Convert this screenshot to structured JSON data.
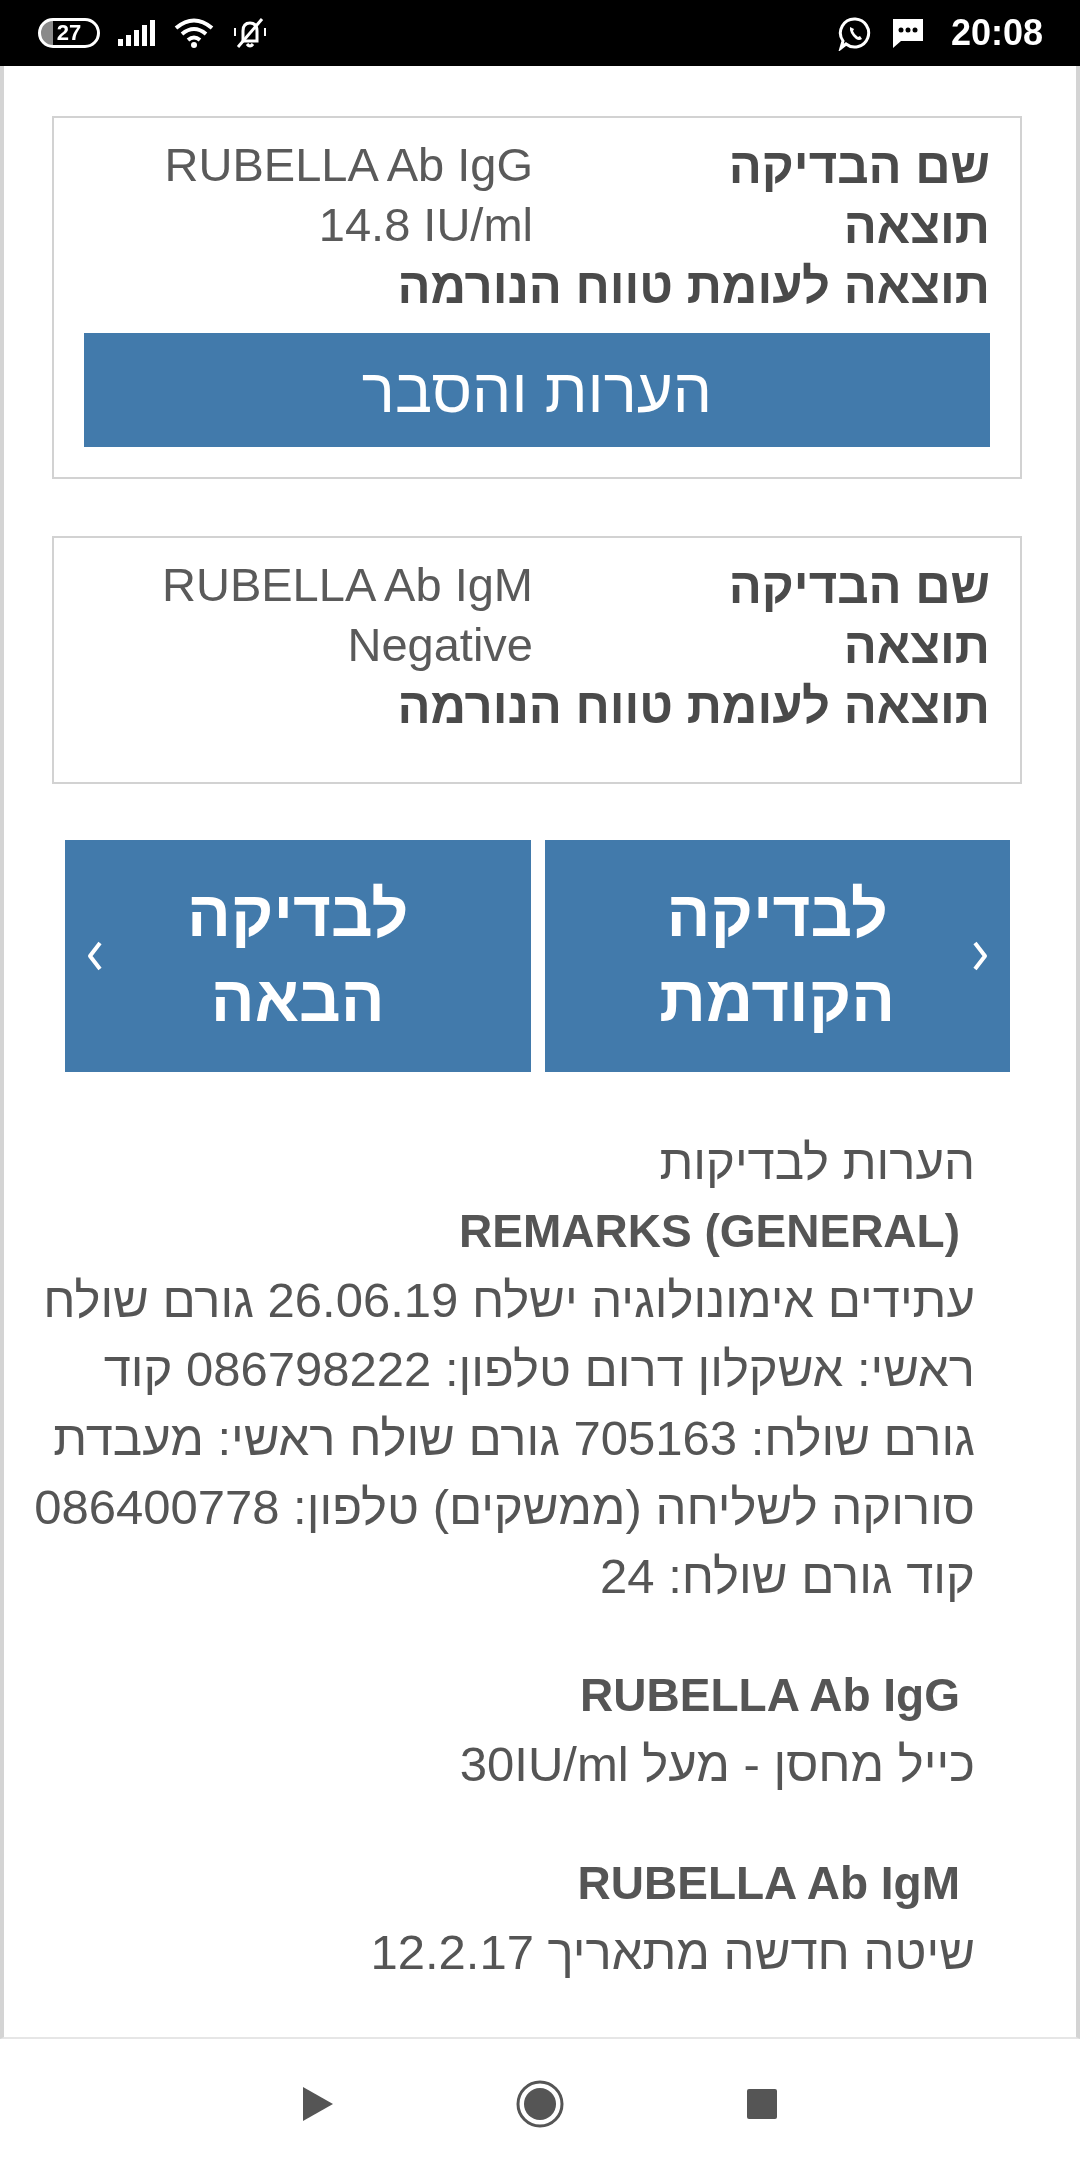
{
  "status_bar": {
    "battery": "27",
    "time": "20:08"
  },
  "tests": [
    {
      "rows": [
        {
          "label": "שם הבדיקה",
          "value": "RUBELLA Ab IgG"
        },
        {
          "label": "תוצאה",
          "value": "14.8 IU/ml"
        },
        {
          "label": "תוצאה לעומת טווח הנורמה"
        }
      ],
      "button": "הערות והסבר"
    },
    {
      "rows": [
        {
          "label": "שם הבדיקה",
          "value": "RUBELLA Ab IgM"
        },
        {
          "label": "תוצאה",
          "value": "Negative"
        },
        {
          "label": "תוצאה לעומת טווח הנורמה"
        }
      ]
    }
  ],
  "navigation": [
    {
      "kind": "previous",
      "label": "לבדיקה הקודמת"
    },
    {
      "kind": "next",
      "label": "לבדיקה הבאה"
    }
  ],
  "remarks": {
    "title": "הערות לבדיקות",
    "sections": [
      {
        "heading": "REMARKS (GENERAL)",
        "text": "עתידים אימונולוגיה ישלח 26.06.19 גורם שולח ראשי: אשקלון דרום טלפון: 086798222 קוד גורם שולח: 705163 גורם שולח ראשי: מעבדת סורוקה לשליחה (ממשקים) טלפון: 086400778 קוד גורם שולח: 24"
      },
      {
        "heading": "RUBELLA Ab IgG",
        "text": "כייל מחסן - מעל 30IU/ml"
      },
      {
        "heading": "RUBELLA Ab IgM",
        "text": "שיטה חדשה מתאריך 12.2.17"
      }
    ]
  }
}
